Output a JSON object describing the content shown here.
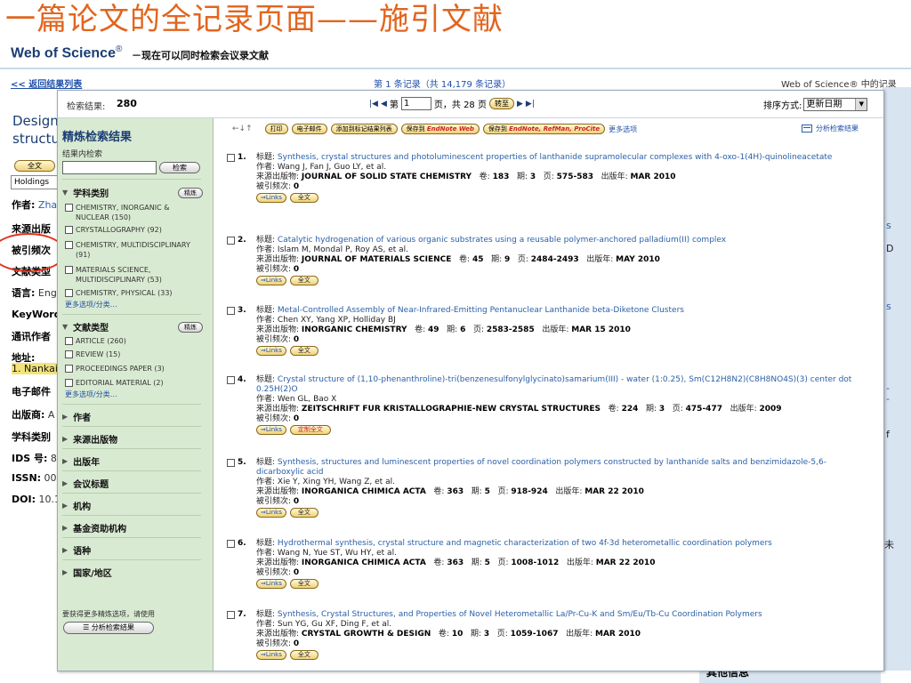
{
  "slide_title": "一篇论文的全记录页面——施引文献",
  "wos": {
    "logo": "Web of Science",
    "reg": "®",
    "subtitle": "－现在可以同时检索会议录文献"
  },
  "background": {
    "back_link": "<< 返回结果列表",
    "record_nav": "第 1 条记录（共 14,179 条记录）",
    "right_text": "Web of Science® 中的记录",
    "title": "Design\nstructu",
    "fulltext_btn": "全文",
    "holdings": "Holdings",
    "fields": [
      {
        "label": "作者:",
        "value": " Zha"
      },
      {
        "label": "来源出版",
        "value": ""
      },
      {
        "label": "被引频次",
        "value": ""
      },
      {
        "label": "文献类型",
        "value": ""
      },
      {
        "label": "语言:",
        "value": " Eng"
      },
      {
        "label": "KeyWord",
        "value": ""
      },
      {
        "label": "通讯作者",
        "value": ""
      },
      {
        "label": "地址:",
        "value": ""
      },
      {
        "label": "",
        "value": "1. Nankai"
      },
      {
        "label": "电子邮件",
        "value": ""
      },
      {
        "label": "出版商:",
        "value": " A"
      },
      {
        "label": "学科类别",
        "value": ""
      },
      {
        "label": "IDS 号:",
        "value": " 8"
      },
      {
        "label": "ISSN:",
        "value": " 00"
      },
      {
        "label": "DOI:",
        "value": " 10.1"
      }
    ],
    "right_frags": [
      "s",
      "D",
      "s",
      "-",
      "-",
      "f",
      "未"
    ],
    "other_info": "其他信息"
  },
  "popup": {
    "count_label": "检索结果:",
    "count": "280",
    "page_label_pre": "第",
    "page_value": "1",
    "page_label_post": "页，共 28 页",
    "go": "转至",
    "sort_label": "排序方式:",
    "sort_value": "更新日期",
    "sidebar": {
      "title": "精炼检索结果",
      "within_label": "结果内检索",
      "search_btn": "检索",
      "refine_btn": "精炼",
      "subject_head": "学科类别",
      "subjects": [
        "CHEMISTRY, INORGANIC & NUCLEAR (150)",
        "CRYSTALLOGRAPHY (92)",
        "CHEMISTRY, MULTIDISCIPLINARY (91)",
        "MATERIALS SCIENCE, MULTIDISCIPLINARY (53)",
        "CHEMISTRY, PHYSICAL (33)"
      ],
      "more": "更多选项/分类…",
      "doctype_head": "文献类型",
      "doctypes": [
        "ARTICLE (260)",
        "REVIEW (15)",
        "PROCEEDINGS PAPER (3)",
        "EDITORIAL MATERIAL (2)"
      ],
      "collapsed": [
        "作者",
        "来源出版物",
        "出版年",
        "会议标题",
        "机构",
        "基金资助机构",
        "语种",
        "国家/地区"
      ],
      "note": "要获得更多精炼选项，请使用",
      "analyze_btn": "分析检索结果"
    },
    "toolbar": {
      "sep": "←↓↑",
      "print": "打印",
      "email": "电子邮件",
      "add_marked": "添加到标记结果列表",
      "save_prefix": "保存到",
      "save_endnote_web": "EndNote Web",
      "save_endnote_refman": "EndNote, RefMan, ProCite",
      "more": "更多选项",
      "analyze": "分析检索结果"
    },
    "labels": {
      "title": "标题:",
      "author": "作者:",
      "source": "来源出版物:",
      "vol": "卷:",
      "issue": "期:",
      "pages": "页:",
      "year": "出版年:",
      "cited": "被引频次:",
      "links": "Links",
      "fulltext": "全文",
      "custom_fulltext": "定制全文"
    },
    "results": [
      {
        "num": "1.",
        "title": "Synthesis, crystal structures and photoluminescent properties of lanthanide supramolecular complexes with 4-oxo-1(4H)-quinolineacetate",
        "authors": "Wang J, Fan J, Guo LY, et al.",
        "source": "JOURNAL OF SOLID STATE CHEMISTRY",
        "vol": "183",
        "issue": "3",
        "pages": "575-583",
        "year": "MAR 2010",
        "cited": "0",
        "fulltext": "全文"
      },
      {
        "num": "2.",
        "title": "Catalytic hydrogenation of various organic substrates using a reusable polymer-anchored palladium(II) complex",
        "authors": "Islam M, Mondal P, Roy AS, et al.",
        "source": "JOURNAL OF MATERIALS SCIENCE",
        "vol": "45",
        "issue": "9",
        "pages": "2484-2493",
        "year": "MAY 2010",
        "cited": "0",
        "fulltext": "全文"
      },
      {
        "num": "3.",
        "title": "Metal-Controlled Assembly of Near-Infrared-Emitting Pentanuclear Lanthanide beta-Diketone Clusters",
        "authors": "Chen XY, Yang XP, Holliday BJ",
        "source": "INORGANIC CHEMISTRY",
        "vol": "49",
        "issue": "6",
        "pages": "2583-2585",
        "year": "MAR 15 2010",
        "cited": "0",
        "fulltext": "全文"
      },
      {
        "num": "4.",
        "title": "Crystal structure of (1,10-phenanthroline)-tri(benzenesulfonylglycinato)samarium(III) - water (1:0.25), Sm(C12H8N2)(C8H8NO4S)(3) center dot 0.25H(2)O",
        "authors": "Wen GL, Bao X",
        "source": "ZEITSCHRIFT FUR KRISTALLOGRAPHIE-NEW CRYSTAL STRUCTURES",
        "vol": "224",
        "issue": "3",
        "pages": "475-477",
        "year": "2009",
        "cited": "0",
        "fulltext": "定制全文"
      },
      {
        "num": "5.",
        "title": "Synthesis, structures and luminescent properties of novel coordination polymers constructed by lanthanide salts and benzimidazole-5,6-dicarboxylic acid",
        "authors": "Xie Y, Xing YH, Wang Z, et al.",
        "source": "INORGANICA CHIMICA ACTA",
        "vol": "363",
        "issue": "5",
        "pages": "918-924",
        "year": "MAR 22 2010",
        "cited": "0",
        "fulltext": "全文"
      },
      {
        "num": "6.",
        "title": "Hydrothermal synthesis, crystal structure and magnetic characterization of two 4f-3d heterometallic coordination polymers",
        "authors": "Wang N, Yue ST, Wu HY, et al.",
        "source": "INORGANICA CHIMICA ACTA",
        "vol": "363",
        "issue": "5",
        "pages": "1008-1012",
        "year": "MAR 22 2010",
        "cited": "0",
        "fulltext": "全文"
      },
      {
        "num": "7.",
        "title": "Synthesis, Crystal Structures, and Properties of Novel Heterometallic La/Pr-Cu-K and Sm/Eu/Tb-Cu Coordination Polymers",
        "authors": "Sun YG, Gu XF, Ding F, et al.",
        "source": "CRYSTAL GROWTH & DESIGN",
        "vol": "10",
        "issue": "3",
        "pages": "1059-1067",
        "year": "MAR 2010",
        "cited": "0",
        "fulltext": "全文"
      }
    ]
  },
  "colors": {
    "title_orange": "#e2651e",
    "wos_navy": "#1b3d73",
    "sidebar_green": "#d9ead2",
    "link_blue": "#2a5fa8",
    "oval_red": "#e0331c"
  }
}
